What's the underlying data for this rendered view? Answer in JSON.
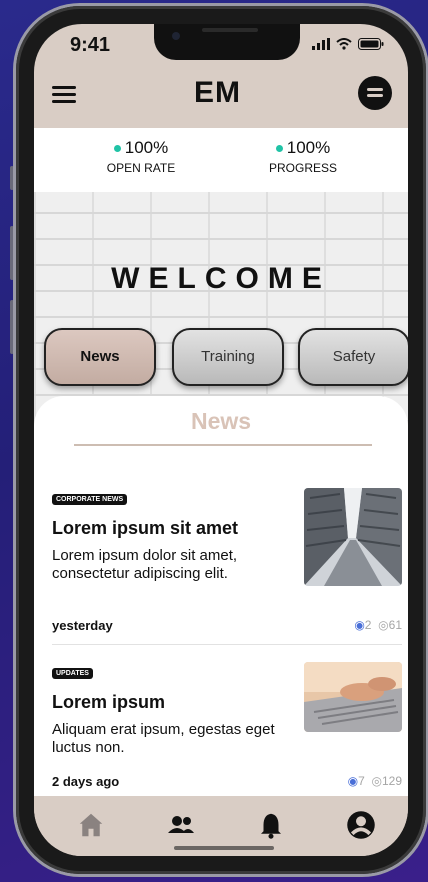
{
  "status_bar": {
    "time": "9:41"
  },
  "header": {
    "logo": "EM"
  },
  "stats": [
    {
      "value": "100%",
      "label": "OPEN RATE",
      "color": "#20c3a6"
    },
    {
      "value": "100%",
      "label": "PROGRESS",
      "color": "#20c3a6"
    }
  ],
  "hero": {
    "welcome": "WELCOME"
  },
  "tabs": [
    {
      "label": "News",
      "active": true
    },
    {
      "label": "Training",
      "active": false
    },
    {
      "label": "Safety",
      "active": false
    }
  ],
  "news": {
    "title": "News",
    "articles": [
      {
        "category": "CORPORATE NEWS",
        "title": "Lorem ipsum sit amet",
        "body": "Lorem ipsum dolor sit amet, consectetur adipiscing elit.",
        "date": "yesterday",
        "likes": "2",
        "views": "61",
        "image": "buildings-photo"
      },
      {
        "category": "UPDATES",
        "title": "Lorem ipsum",
        "body": "Aliquam erat ipsum, egestas eget luctus non.",
        "date": "2 days ago",
        "likes": "7",
        "views": "129",
        "image": "laptop-typing-photo"
      }
    ]
  },
  "tabbar": {
    "items": [
      {
        "icon": "home-icon"
      },
      {
        "icon": "users-icon"
      },
      {
        "icon": "bell-icon"
      },
      {
        "icon": "profile-icon"
      }
    ]
  },
  "colors": {
    "accent": "#20c3a6",
    "beige": "#d9cdc5",
    "like": "#4a6fd8"
  }
}
